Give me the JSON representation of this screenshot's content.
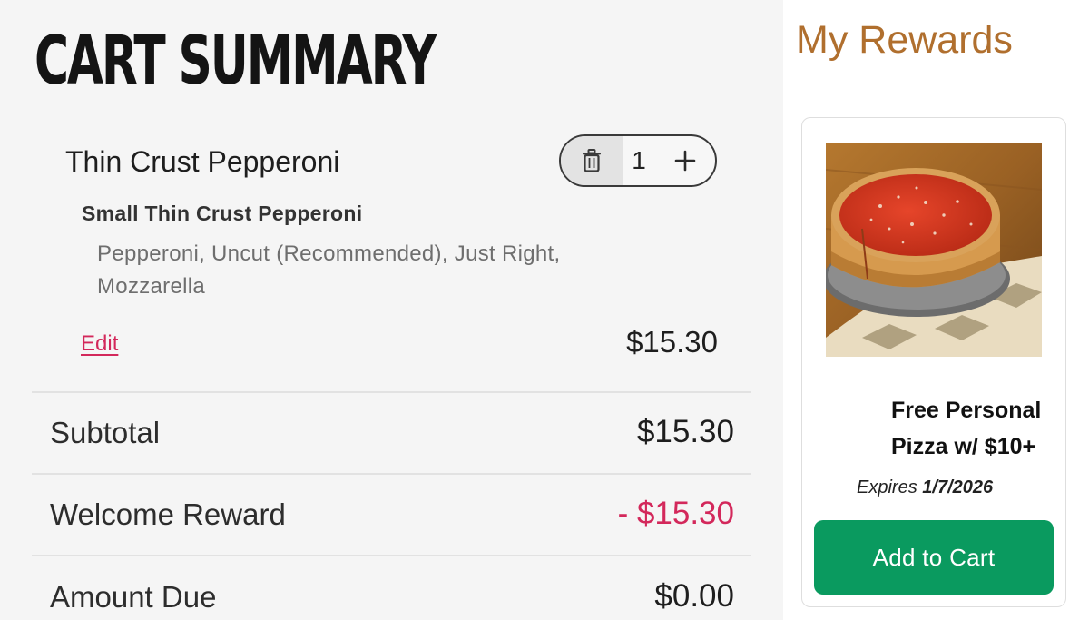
{
  "cart": {
    "title": "CART SUMMARY",
    "item": {
      "name": "Thin Crust Pepperoni",
      "quantity": "1",
      "variant": "Small Thin Crust Pepperoni",
      "options": "Pepperoni, Uncut (Recommended), Just Right, Mozzarella",
      "edit_label": "Edit",
      "price": "$15.30"
    },
    "summary": {
      "subtotal_label": "Subtotal",
      "subtotal_value": "$15.30",
      "reward_label": "Welcome Reward",
      "reward_value": "- $15.30",
      "amount_due_label": "Amount Due",
      "amount_due_value": "$0.00"
    }
  },
  "rewards": {
    "title": "My Rewards",
    "card": {
      "image_icon": "deep-dish-pizza-photo",
      "title": "Free Personal Pizza w/ $10+",
      "expires_label": "Expires",
      "expires_date": "1/7/2026",
      "button_label": "Add to Cart"
    }
  },
  "colors": {
    "accent_red": "#d3285b",
    "rewards_brown": "#b06f2e",
    "button_green": "#0a9a5f",
    "panel_gray": "#f5f5f5"
  }
}
